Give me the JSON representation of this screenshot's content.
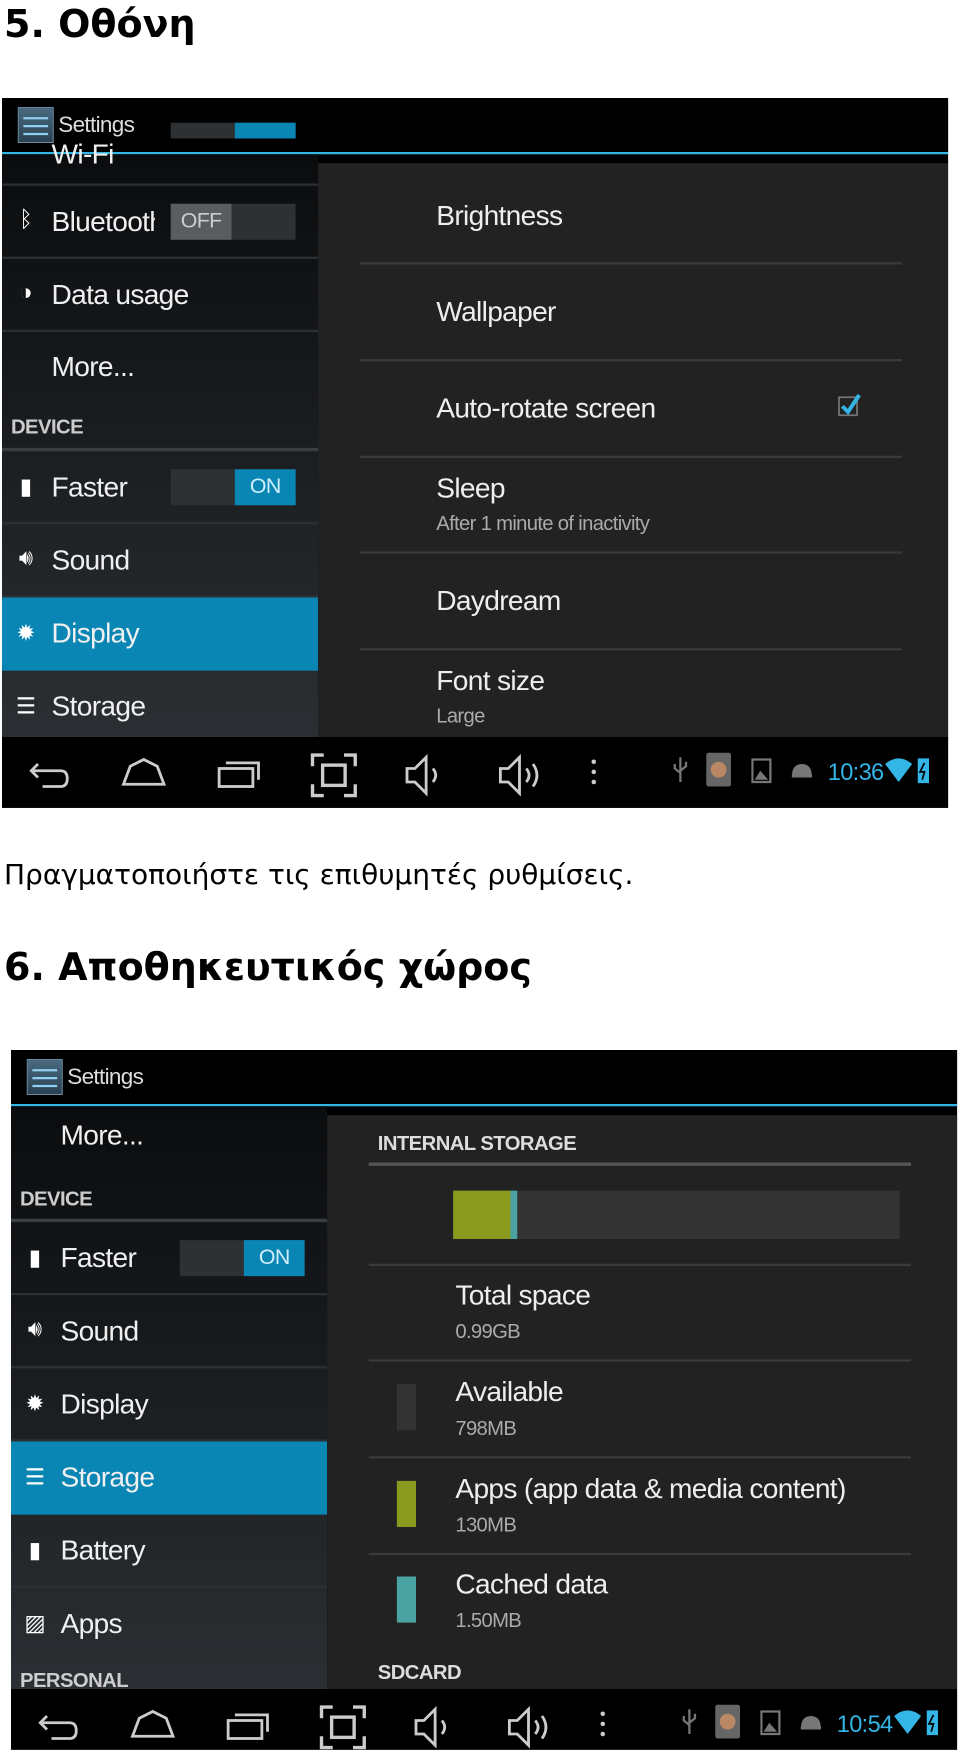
{
  "section5": {
    "heading": "5. Οθόνη",
    "caption": "Πραγματοποιήστε τις επιθυμητές ρυθμίσεις."
  },
  "section6": {
    "heading": "6. Αποθηκευτικός χώρος"
  },
  "screen1": {
    "title": "Settings",
    "sidebar": {
      "items": [
        {
          "label": "Wi-Fi",
          "icon": "wifi-icon"
        },
        {
          "label": "Bluetooth",
          "icon": "bluetooth-icon",
          "toggle": "OFF"
        },
        {
          "label": "Data usage",
          "icon": "data-usage-icon"
        },
        {
          "label": "More..."
        },
        {
          "label": "Faster",
          "icon": "battery-icon",
          "toggle": "ON"
        },
        {
          "label": "Sound",
          "icon": "speaker-icon"
        },
        {
          "label": "Display",
          "icon": "brightness-icon",
          "selected": true
        },
        {
          "label": "Storage",
          "icon": "storage-icon"
        }
      ],
      "device_header": "DEVICE"
    },
    "main": {
      "items": [
        {
          "title": "Brightness"
        },
        {
          "title": "Wallpaper"
        },
        {
          "title": "Auto-rotate screen",
          "checked": true
        },
        {
          "title": "Sleep",
          "summary": "After 1 minute of inactivity"
        },
        {
          "title": "Daydream"
        },
        {
          "title": "Font size",
          "summary": "Large"
        }
      ]
    },
    "status": {
      "time": "10:36"
    }
  },
  "screen2": {
    "title": "Settings",
    "sidebar": {
      "items": [
        {
          "label": "More..."
        },
        {
          "label": "Faster",
          "icon": "battery-icon",
          "toggle": "ON"
        },
        {
          "label": "Sound",
          "icon": "speaker-icon"
        },
        {
          "label": "Display",
          "icon": "brightness-icon"
        },
        {
          "label": "Storage",
          "icon": "storage-icon",
          "selected": true
        },
        {
          "label": "Battery",
          "icon": "battery-icon"
        },
        {
          "label": "Apps",
          "icon": "apps-icon"
        }
      ],
      "device_header": "DEVICE",
      "personal_header": "PERSONAL"
    },
    "main": {
      "section": "INTERNAL STORAGE",
      "usage_bar": {
        "apps_mb": 130,
        "cached_mb": 1.5,
        "total_gb": 0.99
      },
      "items": [
        {
          "title": "Total space",
          "summary": "0.99GB"
        },
        {
          "title": "Available",
          "summary": "798MB",
          "color": "#333333"
        },
        {
          "title": "Apps (app data & media content)",
          "summary": "130MB",
          "color": "#8a9a1f"
        },
        {
          "title": "Cached data",
          "summary": "1.50MB",
          "color": "#4aa3a0"
        }
      ],
      "next_section": "SDCARD"
    },
    "status": {
      "time": "10:54"
    }
  },
  "colors": {
    "accent": "#33b5e5",
    "selected": "#0a86b4"
  }
}
